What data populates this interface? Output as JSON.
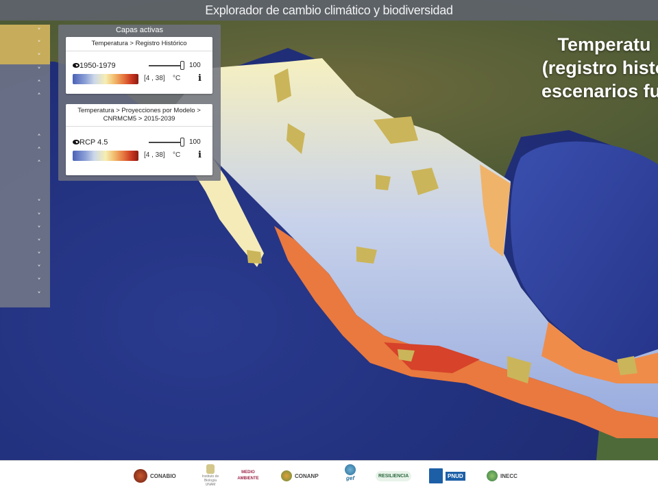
{
  "app": {
    "title": "Explorador de cambio climático y biodiversidad"
  },
  "map": {
    "heading_lines": [
      "Temperatu",
      "(registro histó",
      "escenarios fut"
    ]
  },
  "capas_panel": {
    "title": "Capas activas",
    "layers": [
      {
        "breadcrumb": "Temperatura > Registro Histórico",
        "period": "1950-1979",
        "opacity": "100",
        "range": "[4 , 38]",
        "unit": "°C",
        "info": "i"
      },
      {
        "breadcrumb": "Temperatura > Proyecciones por Modelo > CNRMCM5 > 2015-2039",
        "period": "RCP 4.5",
        "opacity": "100",
        "range": "[4 , 38]",
        "unit": "°C",
        "info": "i"
      }
    ]
  },
  "rail": {
    "chevrons": [
      "˅",
      "˅",
      "˅",
      "˅",
      "˄",
      "˄",
      "˄",
      "˄",
      "˄",
      "˅",
      "˅",
      "˅",
      "˅",
      "˅",
      "˅",
      "˅",
      "˅"
    ]
  },
  "footer": {
    "logos": [
      {
        "name": "CONABIO",
        "icon": "conabio-logo"
      },
      {
        "name": "Instituto de Biología UNAM",
        "icon": "unam-logo"
      },
      {
        "name": "MEDIO AMBIENTE",
        "icon": "semarnat-logo"
      },
      {
        "name": "CONANP",
        "icon": "conanp-logo"
      },
      {
        "name": "gef",
        "icon": "gef-logo"
      },
      {
        "name": "RESILIENCIA",
        "icon": "resiliencia-logo"
      },
      {
        "name": "PNUD",
        "icon": "pnud-logo"
      },
      {
        "name": "INECC",
        "icon": "inecc-logo"
      }
    ]
  },
  "colors": {
    "ocean": "#22317d",
    "rail_highlight": "#c7ad5b",
    "panel": "#6e727e"
  }
}
